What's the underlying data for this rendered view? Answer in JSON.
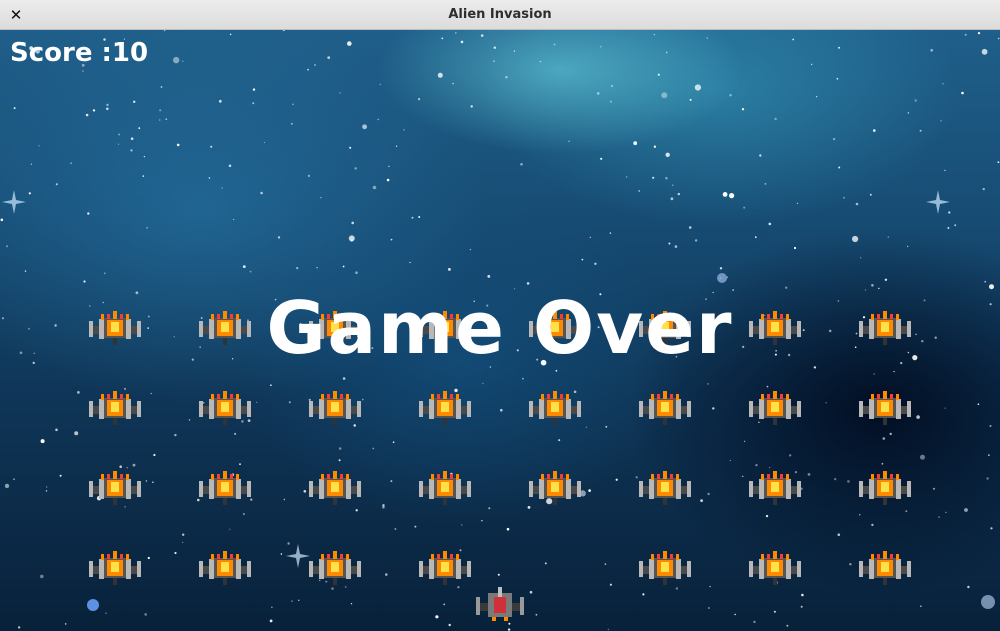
{
  "window": {
    "title": "Alien Invasion",
    "close_glyph": "✕"
  },
  "hud": {
    "score_text": "Score :10"
  },
  "overlay": {
    "text": "Game Over"
  },
  "colors": {
    "alien_body": "#b8b8b8",
    "alien_fire": "#ff8a00",
    "alien_core": "#ffe14a",
    "ship_body": "#7a7a7a",
    "ship_core": "#d0303a"
  },
  "fleet": {
    "rows": [
      [
        true,
        true,
        true,
        true,
        true,
        true,
        true,
        true
      ],
      [
        true,
        true,
        true,
        true,
        true,
        true,
        true,
        true
      ],
      [
        true,
        true,
        true,
        true,
        true,
        true,
        true,
        true
      ],
      [
        true,
        true,
        true,
        true,
        false,
        true,
        true,
        true
      ]
    ]
  },
  "player": {
    "icon": "player-ship-icon"
  }
}
